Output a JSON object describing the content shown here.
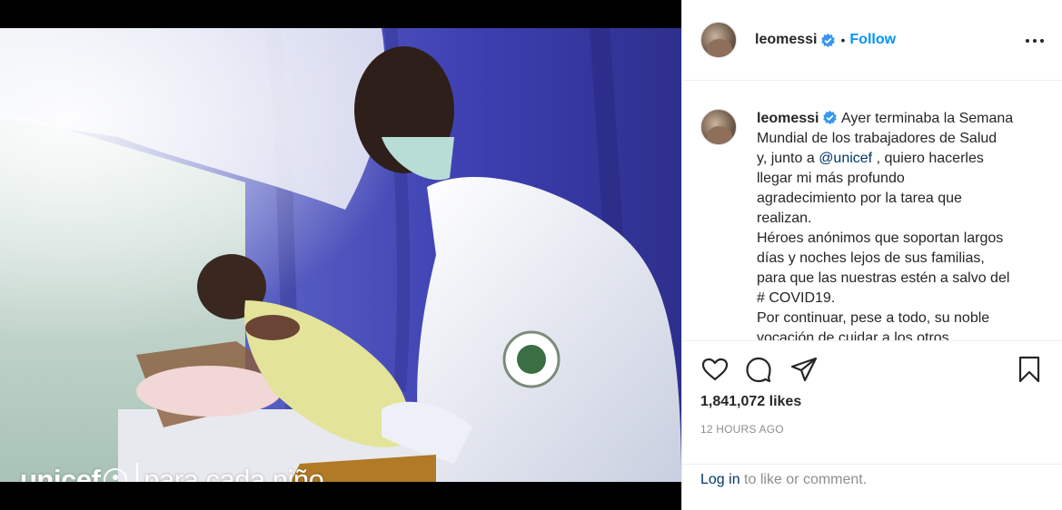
{
  "post": {
    "username": "leomessi",
    "separator": "•",
    "follow_label": "Follow",
    "likes": "1,841,072 likes",
    "timestamp": "12 HOURS AGO"
  },
  "media": {
    "watermark_brand": "unicef",
    "watermark_tagline": "para cada niño"
  },
  "caption": {
    "username": "leomessi",
    "line1_a": "Ayer terminaba la Semana",
    "line2": "Mundial de los trabajadores de Salud",
    "line3_pre": "y, junto a ",
    "mention": "@unicef",
    "line3_post": " , quiero hacerles",
    "line4": "llegar mi más profundo",
    "line5": "agradecimiento por la tarea que",
    "line6": "realizan.",
    "line7": "Héroes anónimos que soportan largos",
    "line8": "días y noches lejos de sus familias,",
    "line9": "para que las nuestras estén a salvo del",
    "line10": "# COVID19.",
    "line11": "Por continuar, pese a todo, su noble",
    "line12": "vocación de cuidar a los otros."
  },
  "footer": {
    "login_link": "Log in",
    "login_rest": " to like or comment."
  },
  "icons": {
    "like": "heart-icon",
    "comment": "comment-icon",
    "share": "paper-plane-icon",
    "save": "bookmark-icon",
    "verified": "verified-badge-icon",
    "more": "more-options-icon"
  },
  "colors": {
    "link_blue": "#0095f6",
    "verified_blue": "#3897f0",
    "mention": "#00376b",
    "muted": "#8e8e8e"
  }
}
